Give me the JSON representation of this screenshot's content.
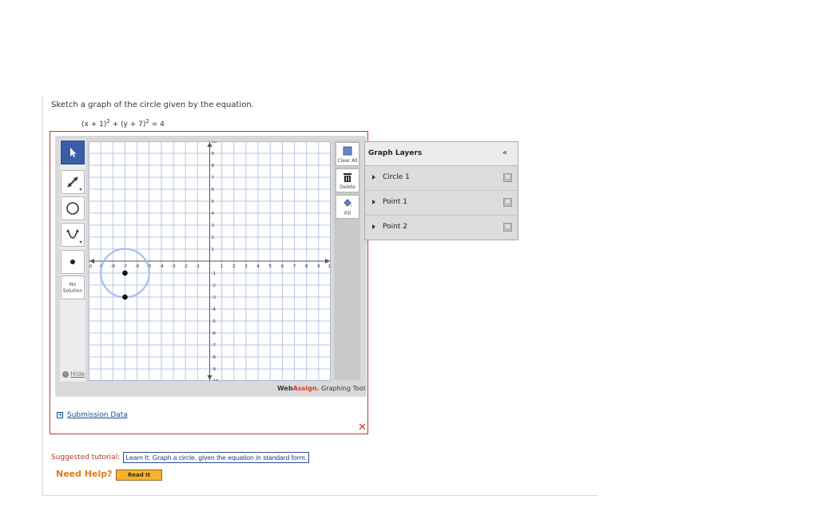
{
  "question": {
    "prompt": "Sketch a graph of the circle given by the equation.",
    "equation_a": "(x + 1)",
    "equation_b": " + (y + 7)",
    "equation_c": " = 4",
    "exponent": "2"
  },
  "toolbar": {
    "no_solution_label_1": "No",
    "no_solution_label_2": "Solution",
    "hide_label": "Hide"
  },
  "side_tools": {
    "clear_all": "Clear All",
    "delete": "Delete",
    "fill": "Fill"
  },
  "graph": {
    "x_range": [
      -10,
      10
    ],
    "y_range": [
      -10,
      10
    ],
    "x_ticks": [
      "-10",
      "-9",
      "-8",
      "-7",
      "-6",
      "-5",
      "-4",
      "-3",
      "-2",
      "-1",
      "1",
      "2",
      "3",
      "4",
      "5",
      "6",
      "7",
      "8",
      "9",
      "10"
    ],
    "y_ticks": [
      "10",
      "9",
      "8",
      "7",
      "6",
      "5",
      "4",
      "3",
      "2",
      "1",
      "-1",
      "-2",
      "-3",
      "-4",
      "-5",
      "-6",
      "-7",
      "-8",
      "-9",
      "-10"
    ],
    "circle": {
      "cx": -7,
      "cy": -1,
      "r": 2
    },
    "points": [
      {
        "x": -7,
        "y": -1
      },
      {
        "x": -7,
        "y": -3
      }
    ],
    "colors": {
      "grid": "#b9c7e6",
      "axis": "#555555",
      "circle": "#9db8ea",
      "point": "#111111"
    }
  },
  "brand": {
    "web": "Web",
    "assign": "Assign.",
    "rest": " Graphing Tool"
  },
  "layers": {
    "title": "Graph Layers",
    "collapse": "«",
    "items": [
      {
        "label": "Circle 1"
      },
      {
        "label": "Point 1"
      },
      {
        "label": "Point 2"
      }
    ]
  },
  "submission": {
    "toggle": "+",
    "label": "Submission Data"
  },
  "tutorial": {
    "prefix": "Suggested tutorial:",
    "link": "Learn It: Graph a circle, given the equation in standard form."
  },
  "help": {
    "label": "Need Help?",
    "read_it": "Read It"
  },
  "close_symbol": "✕"
}
